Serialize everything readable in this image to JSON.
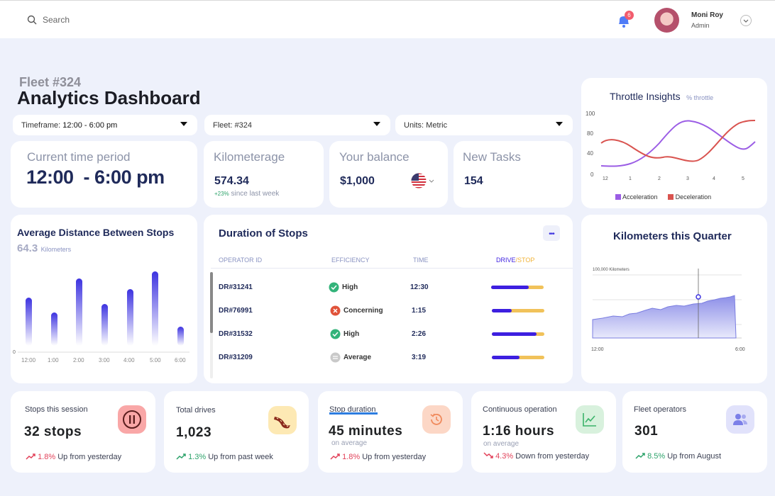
{
  "header": {
    "search_placeholder": "Search",
    "notification_count": "6",
    "user_name": "Moni Roy",
    "user_role": "Admin"
  },
  "page": {
    "fleet_label": "Fleet #324",
    "title": "Analytics Dashboard"
  },
  "filters": {
    "timeframe_label": "Timeframe:",
    "timeframe_value": "12:00 - 6:00 pm",
    "fleet": "Fleet: #324",
    "units": "Units: Metric"
  },
  "kpis": {
    "current_time_title": "Current time period",
    "current_time_value": "12:00  - 6:00 pm",
    "kilometerage_title": "Kilometerage",
    "kilometerage_value": "574.34",
    "kilometerage_delta": "+23%",
    "kilometerage_delta_text": "since last week",
    "balance_title": "Your balance",
    "balance_value": "$1,000",
    "tasks_title": "New Tasks",
    "tasks_value": "154"
  },
  "throttle": {
    "title": "Throttle Insights",
    "subtitle": "% throttle",
    "y_ticks": [
      "100",
      "80",
      "40",
      "0"
    ],
    "x_ticks": [
      "12",
      "1",
      "2",
      "3",
      "4",
      "5"
    ],
    "legend": [
      {
        "name": "Acceleration",
        "color": "#9b5de5"
      },
      {
        "name": "Deceleration",
        "color": "#d9534f"
      }
    ]
  },
  "avg_distance": {
    "title": "Average Distance Between Stops",
    "value": "64.3",
    "unit": "Kilometers",
    "zero_label": "0",
    "x_labels": [
      "12:00",
      "1:00",
      "2:00",
      "3:00",
      "4:00",
      "5:00",
      "6:00"
    ]
  },
  "duration": {
    "title": "Duration of Stops",
    "menu": "•••",
    "col_operator": "OPERATOR ID",
    "col_efficiency": "EFFICIENCY",
    "col_time": "TIME",
    "col_drive": "DRIVE",
    "col_sep": "/",
    "col_stop": "STOP",
    "rows": [
      {
        "id": "DR#31241",
        "efficiency": "High",
        "status": "good",
        "time": "12:30",
        "drive": 0.72
      },
      {
        "id": "DR#76991",
        "efficiency": "Concerning",
        "status": "bad",
        "time": "1:15",
        "drive": 0.38
      },
      {
        "id": "DR#31532",
        "efficiency": "High",
        "status": "good",
        "time": "2:26",
        "drive": 0.85
      },
      {
        "id": "DR#31209",
        "efficiency": "Average",
        "status": "avg",
        "time": "3:19",
        "drive": 0.52
      }
    ]
  },
  "quarter": {
    "title": "Kilometers this Quarter",
    "y_label": "100,000 Kilometers",
    "x_start": "12:00",
    "x_end": "6:00"
  },
  "stats": [
    {
      "title": "Stops this session",
      "value": "32 stops",
      "sub": "",
      "trend_pct": "1.8%",
      "trend_text": "Up from yesterday",
      "dir": "up-red",
      "icon": "pause-icon"
    },
    {
      "title": "Total drives",
      "value": "1,023",
      "sub": "",
      "trend_pct": "1.3%",
      "trend_text": "Up from past week",
      "dir": "up-green",
      "icon": "road-icon"
    },
    {
      "title": "Stop duration",
      "value": "45 minutes",
      "sub": "on average",
      "trend_pct": "1.8%",
      "trend_text": "Up from yesterday",
      "dir": "up-red",
      "icon": "history-icon"
    },
    {
      "title": "Continuous operation",
      "value": "1:16 hours",
      "sub": "on average",
      "trend_pct": "4.3%",
      "trend_text": "Down from yesterday",
      "dir": "down-red",
      "icon": "chart-icon"
    },
    {
      "title": "Fleet operators",
      "value": "301",
      "sub": "",
      "trend_pct": "8.5%",
      "trend_text": "Up from August",
      "dir": "up-green",
      "icon": "users-icon"
    }
  ]
}
